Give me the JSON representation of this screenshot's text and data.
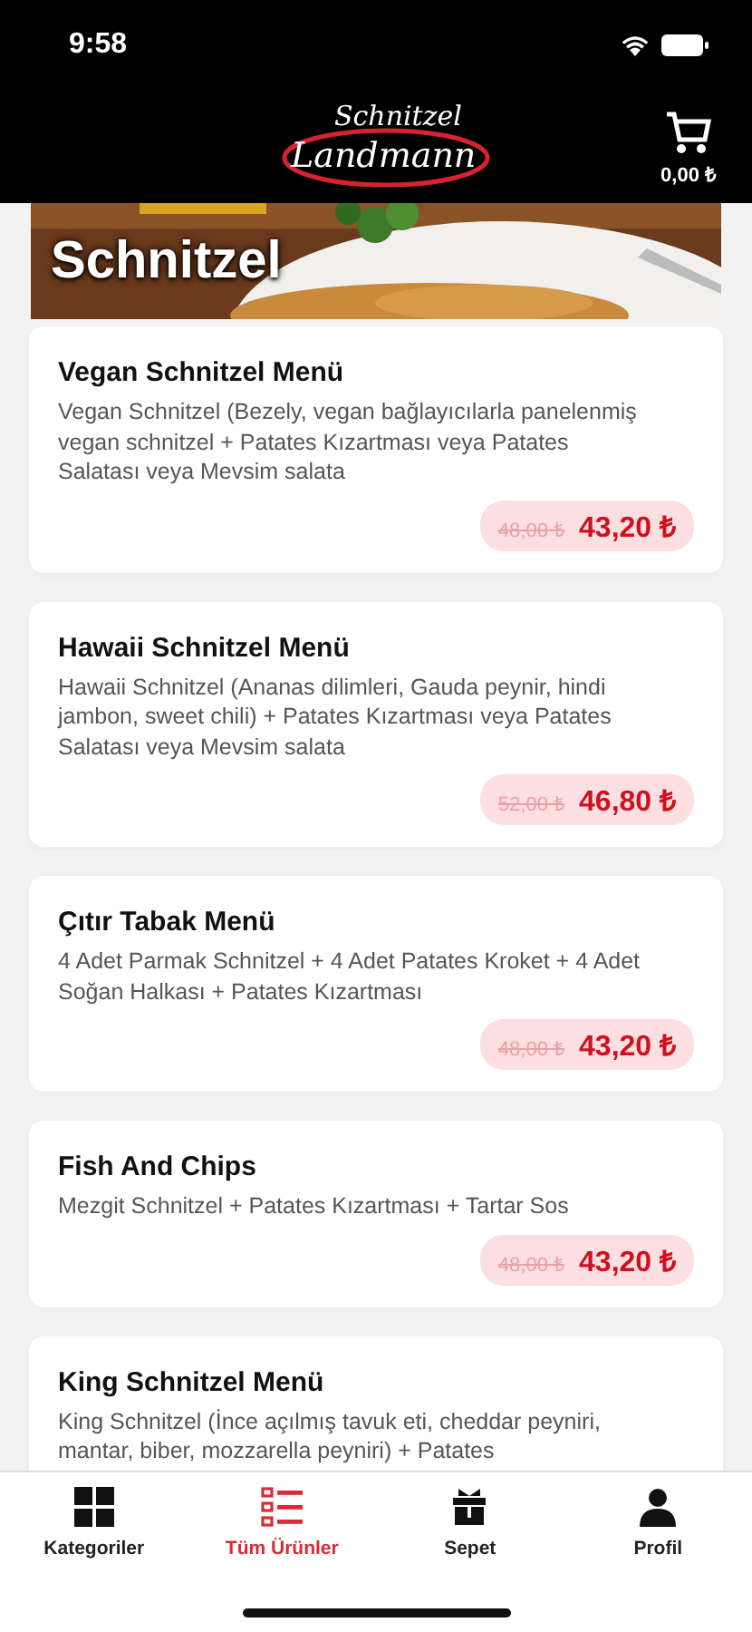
{
  "status_bar": {
    "time": "9:58"
  },
  "header": {
    "logo": {
      "top": "Schnitzel",
      "bottom": "Landmann"
    },
    "cart_total": "0,00 ₺"
  },
  "banner": {
    "kind": "picture",
    "title": "Schnitzel"
  },
  "products": [
    {
      "name": "Vegan Schnitzel Menü",
      "description": "Vegan Schnitzel (Bezely, vegan bağlayıcılarla panelenmiş vegan schnitzel + Patates Kızartması veya Patates Salatası veya Mevsim salata",
      "old_price": "48,00 ₺",
      "price": "43,20 ₺"
    },
    {
      "name": "Hawaii Schnitzel Menü",
      "description": "Hawaii Schnitzel (Ananas dilimleri, Gauda peynir, hindi jambon, sweet chili) + Patates Kızartması veya Patates Salatası veya Mevsim salata",
      "old_price": "52,00 ₺",
      "price": "46,80 ₺"
    },
    {
      "name": "Çıtır Tabak Menü",
      "description": "4 Adet Parmak Schnitzel + 4 Adet Patates Kroket + 4 Adet Soğan Halkası + Patates Kızartması",
      "old_price": "48,00 ₺",
      "price": "43,20 ₺"
    },
    {
      "name": "Fish And Chips",
      "description": "Mezgit Schnitzel + Patates Kızartması + Tartar Sos",
      "old_price": "48,00 ₺",
      "price": "43,20 ₺"
    },
    {
      "name": "King Schnitzel Menü",
      "description": "King Schnitzel (İnce açılmış tavuk eti, cheddar peyniri, mantar, biber, mozzarella peyniri) + Patates"
    }
  ],
  "tab_bar": [
    {
      "kind": "grid",
      "label": "Kategoriler",
      "selected": false
    },
    {
      "kind": "list",
      "label": "Tüm Ürünler",
      "selected": true
    },
    {
      "kind": "gift",
      "label": "Sepet",
      "selected": false
    },
    {
      "kind": "person",
      "label": "Profil",
      "selected": false
    }
  ]
}
